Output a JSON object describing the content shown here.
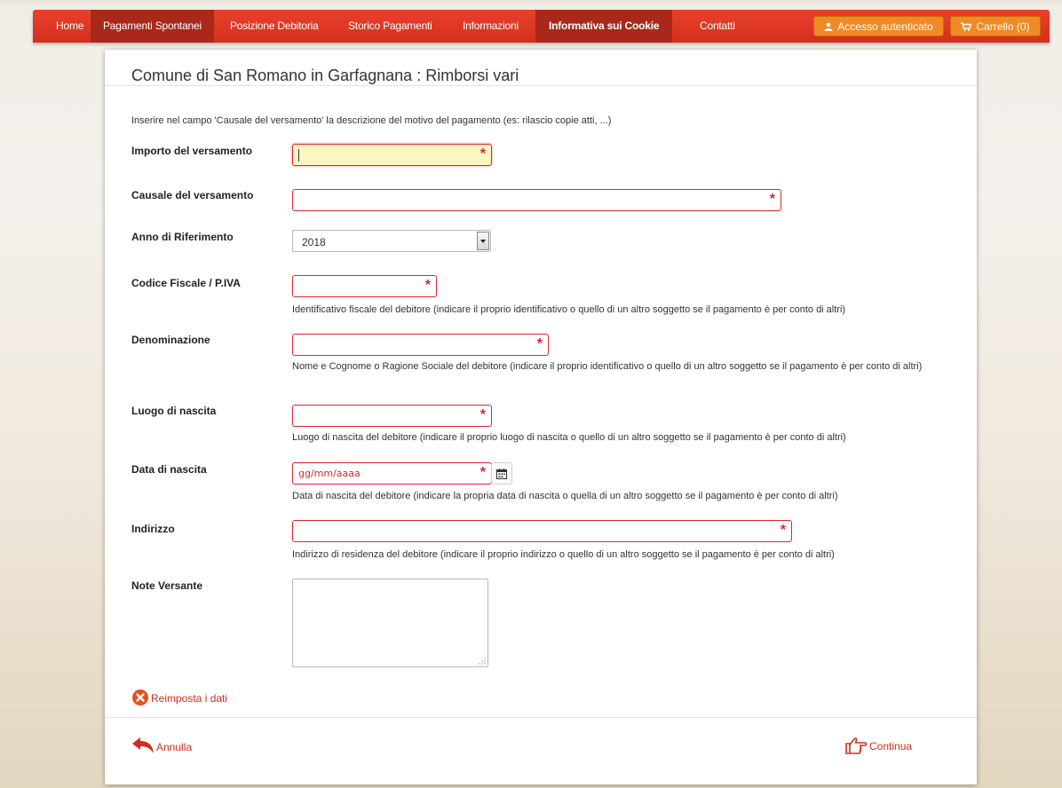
{
  "nav": {
    "items": [
      {
        "label": "Home"
      },
      {
        "label": "Pagamenti Spontanei"
      },
      {
        "label": "Posizione Debitoria"
      },
      {
        "label": "Storico Pagamenti"
      },
      {
        "label": "Informazioni"
      },
      {
        "label": "Informativa sui Cookie"
      },
      {
        "label": "Contatti"
      }
    ],
    "login_label": "Accesso autenticato",
    "cart_label": "Carrello (0)",
    "user_icon": "user-icon",
    "cart_icon": "cart-icon"
  },
  "page": {
    "title": "Comune di San Romano in Garfagnana : Rimborsi vari",
    "intro": "Inserire nel campo 'Causale del versamento' la descrizione del motivo del pagamento (es: rilascio copie atti, ...)"
  },
  "form": {
    "importo": {
      "label": "Importo del versamento",
      "value": ""
    },
    "causale": {
      "label": "Causale del versamento",
      "value": ""
    },
    "anno": {
      "label": "Anno di Riferimento",
      "value": "2018"
    },
    "codice_fiscale": {
      "label": "Codice Fiscale / P.IVA",
      "help": "Identificativo fiscale del debitore (indicare il proprio identificativo o quello di un altro soggetto se il pagamento è per conto di altri)"
    },
    "denominazione": {
      "label": "Denominazione",
      "help": "Nome e Cognome o Ragione Sociale del debitore (indicare il proprio identificativo o quello di un altro soggetto se il pagamento è per conto di altri)"
    },
    "luogo_nascita": {
      "label": "Luogo di nascita",
      "help": "Luogo di nascita del debitore (indicare il proprio luogo di nascita o quello di un altro soggetto se il pagamento è per conto di altri)"
    },
    "data_nascita": {
      "label": "Data di nascita",
      "placeholder": "gg/mm/aaaa",
      "help": "Data di nascita del debitore (indicare la propria data di nascita o quella di un altro soggetto se il pagamento è per conto di altri)"
    },
    "indirizzo": {
      "label": "Indirizzo",
      "help": "Indirizzo di residenza del debitore (indicare il proprio indirizzo o quello di un altro soggetto se il pagamento è per conto di altri)"
    },
    "note": {
      "label": "Note Versante",
      "value": ""
    },
    "required_marker": "*"
  },
  "actions": {
    "reset_label": "Reimposta i dati",
    "cancel_label": "Annulla",
    "continue_label": "Continua"
  },
  "colors": {
    "navbar": "#d5301c",
    "nav_active": "#a9281a",
    "button_orange": "#f08a24",
    "required_red": "#e0242d",
    "focus_yellow": "#fcf7c2"
  }
}
